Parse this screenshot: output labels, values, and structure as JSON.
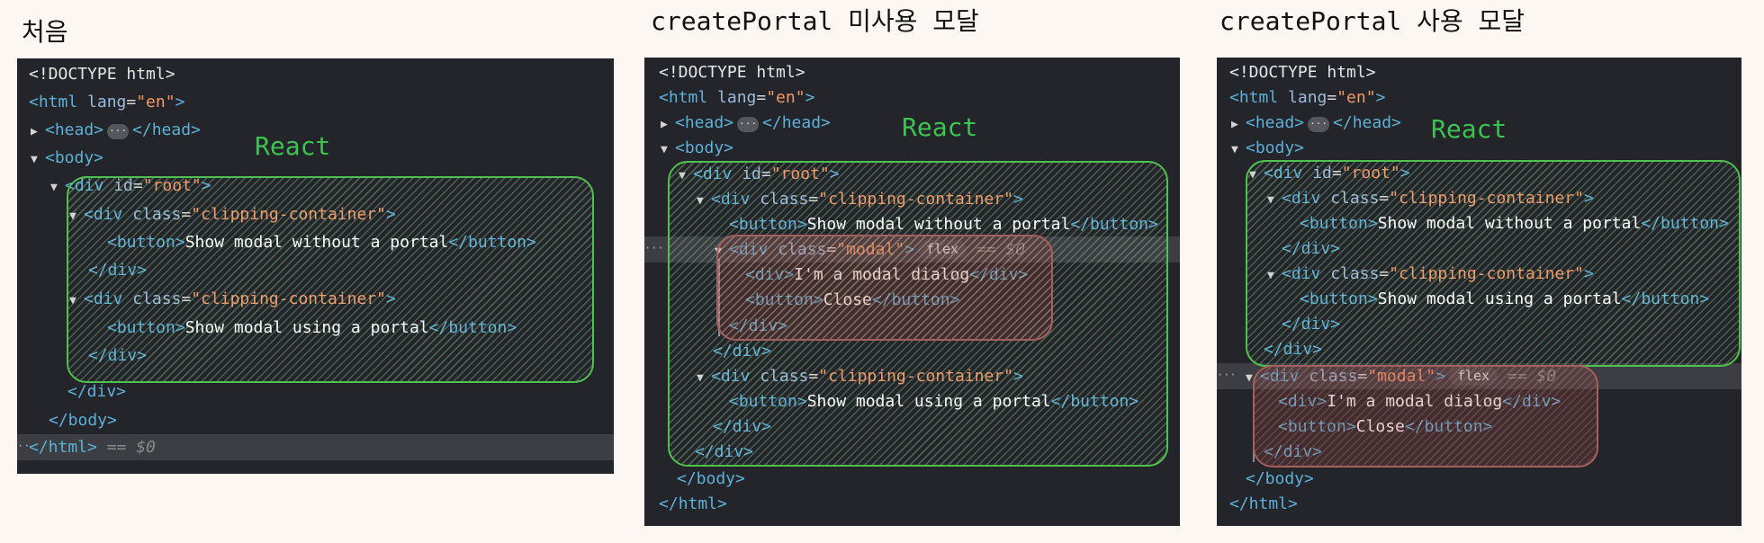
{
  "titles": {
    "panel1": "처음",
    "panel2": "createPortal 미사용 모달",
    "panel3": "createPortal 사용 모달"
  },
  "region_label": "React",
  "dom": {
    "doctype": "<!DOCTYPE html>",
    "html_open": "<html",
    "html_attr": " lang",
    "html_eq": "=",
    "html_val": "\"en\"",
    "html_gt": ">",
    "head_open": "<head>",
    "head_close": "</head>",
    "ellipsis": "···",
    "body_open": "<body>",
    "body_close": "</body>",
    "html_close": "</html>",
    "selected_marker": " == $0",
    "div_open": "<div",
    "div_close": "</div>",
    "id_attr": " id",
    "class_attr": " class",
    "root_val": "\"root\"",
    "clip_val": "\"clipping-container\"",
    "modal_val": "\"modal\"",
    "gt": ">",
    "button_open": "<button>",
    "button_close": "</button>",
    "btn_without": "Show modal without a portal",
    "btn_using": "Show modal using a portal",
    "dialog_text": "I'm a modal dialog",
    "close_text": "Close",
    "flex_badge": "flex"
  }
}
